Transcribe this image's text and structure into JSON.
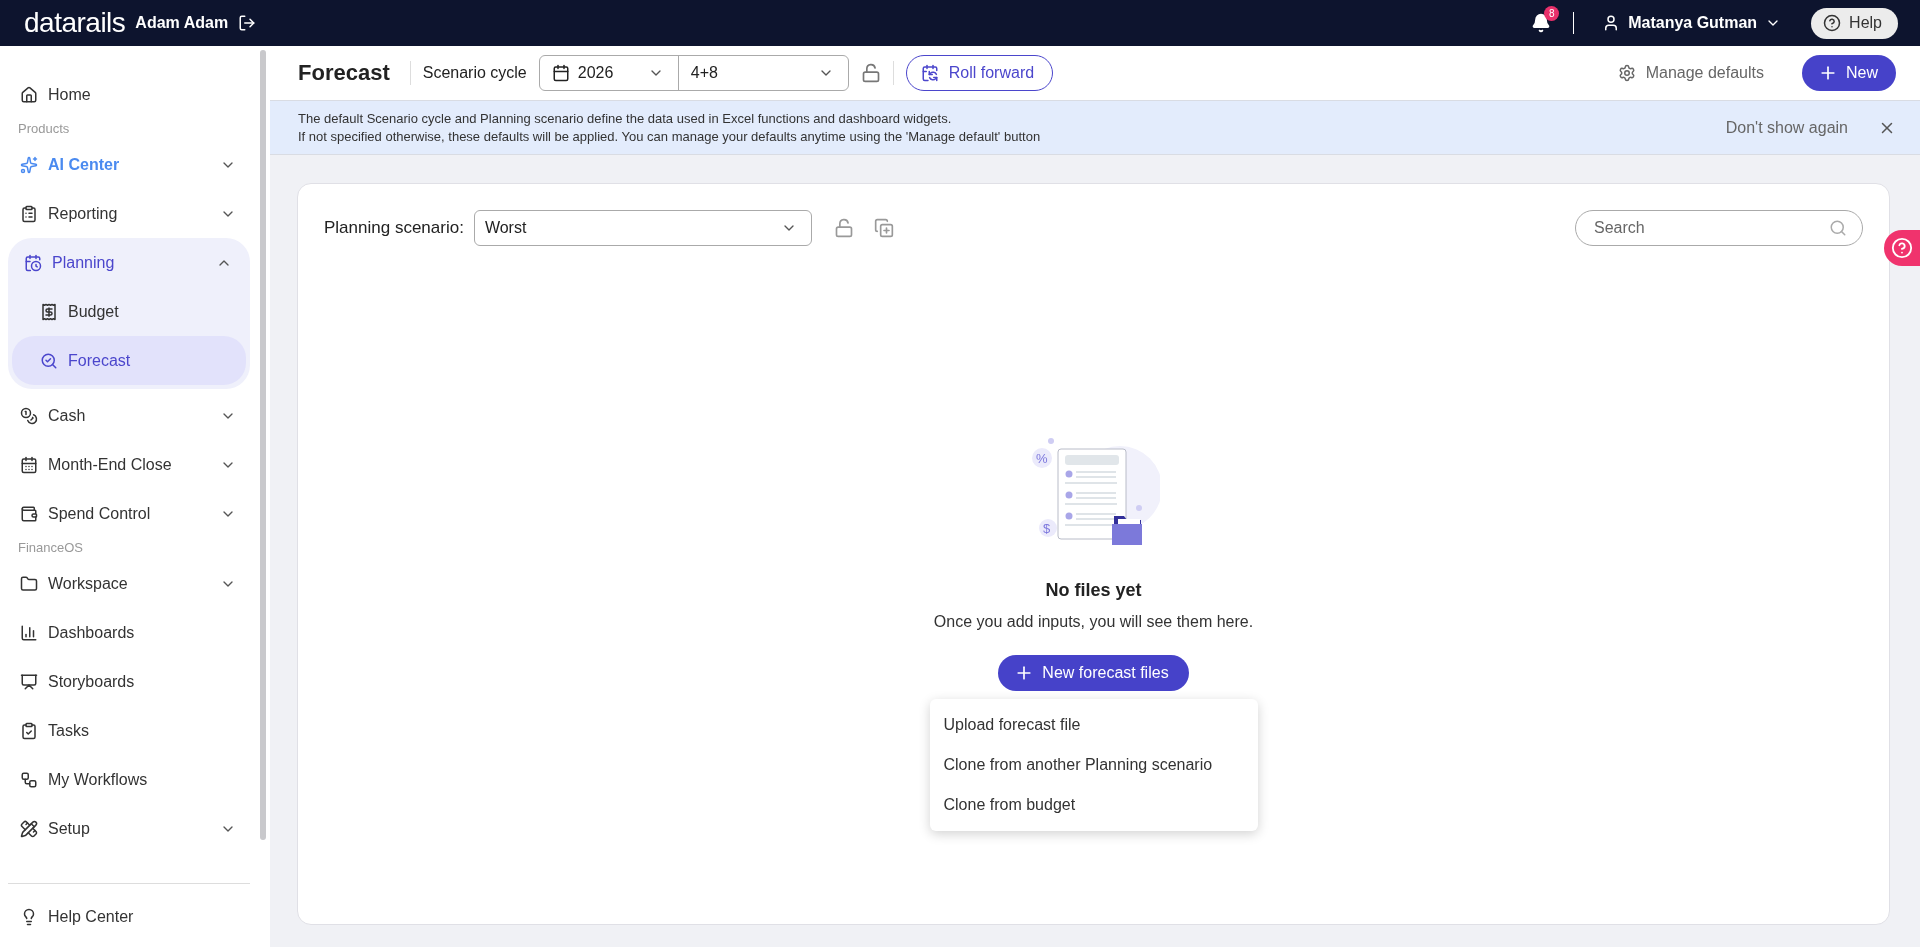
{
  "topbar": {
    "logo": "datarails",
    "workspace": "Adam Adam",
    "notifications": "8",
    "user": "Matanya Gutman",
    "help": "Help"
  },
  "sidebar": {
    "items": [
      {
        "kind": "link",
        "label": "Home",
        "selected": false
      },
      {
        "kind": "section",
        "label": "Products"
      },
      {
        "kind": "accent-menu",
        "label": "AI Center",
        "expanded": false
      },
      {
        "kind": "menu",
        "label": "Reporting",
        "expanded": false
      },
      {
        "kind": "menu",
        "label": "Planning",
        "expanded": true,
        "children": [
          {
            "label": "Budget",
            "selected": false
          },
          {
            "label": "Forecast",
            "selected": true
          }
        ]
      },
      {
        "kind": "menu",
        "label": "Cash",
        "expanded": false
      },
      {
        "kind": "menu",
        "label": "Month-End Close",
        "expanded": false
      },
      {
        "kind": "menu",
        "label": "Spend Control",
        "expanded": false
      },
      {
        "kind": "section",
        "label": "FinanceOS"
      },
      {
        "kind": "menu",
        "label": "Workspace",
        "expanded": false
      },
      {
        "kind": "link",
        "label": "Dashboards",
        "selected": false
      },
      {
        "kind": "link",
        "label": "Storyboards",
        "selected": false
      },
      {
        "kind": "link",
        "label": "Tasks",
        "selected": false
      },
      {
        "kind": "link",
        "label": "My Workflows",
        "selected": false
      },
      {
        "kind": "menu",
        "label": "Setup",
        "expanded": false
      }
    ],
    "footer": "Help Center"
  },
  "header": {
    "title": "Forecast",
    "cycle_label": "Scenario cycle",
    "year": "2026",
    "period": "4+8",
    "roll_forward": "Roll forward",
    "manage_defaults": "Manage defaults",
    "new": "New"
  },
  "banner": {
    "lines": [
      "The default Scenario cycle and Planning scenario define the data used in Excel functions and dashboard widgets.",
      "If not specified otherwise, these defaults will be applied. You can manage your defaults anytime using the 'Manage default' button"
    ],
    "dismiss": "Don't show again"
  },
  "card": {
    "scenario_label": "Planning scenario:",
    "scenario": "Worst",
    "search": {
      "placeholder": "Search"
    },
    "empty": {
      "marks": [
        "%",
        "$"
      ],
      "title": "No files yet",
      "text": "Once you add inputs, you will see them here.",
      "button": "New forecast files"
    },
    "menu": [
      "Upload forecast file",
      "Clone from another Planning scenario",
      "Clone from budget"
    ]
  }
}
